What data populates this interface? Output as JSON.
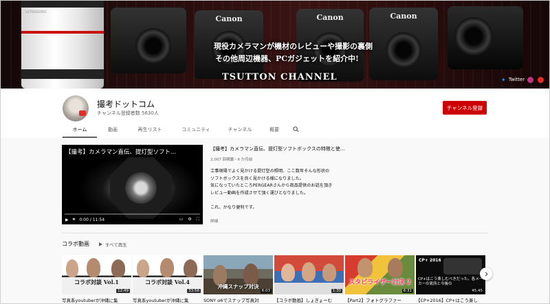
{
  "banner": {
    "camera_brands": [
      "Canon",
      "Canon",
      "Canon"
    ],
    "lens_left_text": "ULTRASONIC",
    "headline_1": "現役カメラマンが機材のレビューや撮影の裏側",
    "headline_2": "その他周辺機器、PCガジェットを紹介中!",
    "channel_banner_name": "TSUTTON CHANNEL",
    "social": {
      "twitter_label": "Twitter"
    },
    "colors": {
      "instagram": "#c13584",
      "youtube": "#e52d27"
    }
  },
  "channel": {
    "name": "撮考ドットコム",
    "subscribers": "チャンネル登録者数 5630人",
    "subscribe_label": "チャンネル登録",
    "subscribe_color": "#cc0000"
  },
  "tabs": [
    {
      "label": "ホーム",
      "active": true
    },
    {
      "label": "動画"
    },
    {
      "label": "再生リスト"
    },
    {
      "label": "コミュニティ"
    },
    {
      "label": "チャンネル"
    },
    {
      "label": "概要"
    }
  ],
  "search_icon": "search-icon",
  "featured": {
    "player_title": "【撮考】カメラマン直伝、提灯型ソフト...",
    "time": "0:00 / 11:54",
    "title": "【撮考】カメラマン直伝、提灯型ソフトボックスの特徴と使...",
    "meta": "2,007 回視聴・6 か月前",
    "description": [
      "工事現場でよく見かける提灯型の照明、ここ数年そんな形状の",
      "ソフトボックスを良く見かける様になりました。",
      "気になっていたところPERGEARさんから商品提供のお話を頂き",
      "レビュー動画を作成させて頂く運びとなりました。",
      "",
      "これ、かなり便利です。"
    ],
    "more": "詳細"
  },
  "collab": {
    "title": "コラボ動画",
    "play_all": "すべて再生",
    "videos": [
      {
        "title": "写真系youtuberが沖縄に集",
        "duration": "12:49",
        "overlay": "コラボ対談 Vol.1"
      },
      {
        "title": "写真系youtuberが沖縄に集",
        "duration": "33:56",
        "overlay": "コラボ対談 Vol.4"
      },
      {
        "title": "SONY α6でスナップ写真対",
        "duration": "6:03",
        "overlay": "沖縄スナップ対決"
      },
      {
        "title": "【コラボ動画】しょぎょーむ",
        "duration": "1:30",
        "overlay": ""
      },
      {
        "title": "【Part2】フォトグラファー",
        "duration": "6:31",
        "overlay": "スタビライザー対決 2"
      },
      {
        "title": "【CP+2016】CP+はこう楽し",
        "duration": "45:45",
        "overlay": "CP+はこう楽しむべきだった。各メーカーの見所と今後の"
      }
    ],
    "thumb6_badge": "CP+ 2016"
  }
}
